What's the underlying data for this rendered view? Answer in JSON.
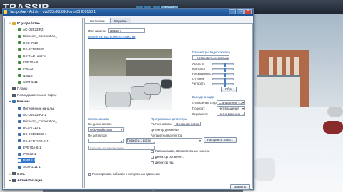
{
  "app": {
    "logo": "TRASSIR",
    "tabs": [
      "",
      "",
      "",
      "Cam1"
    ],
    "active_tab": 3
  },
  "dialog": {
    "title": "Настройки - Admin - dvd-55b98b69cKamaOhID5150 1",
    "tree": [
      {
        "label": "IP-устройства",
        "type": "section"
      },
      {
        "label": "AC-D2023IR2",
        "icon": "camera"
      },
      {
        "label": "Brickcom_Corporation_",
        "icon": "camera"
      },
      {
        "label": "DCS-7110",
        "icon": "camera"
      },
      {
        "label": "DS-2CD854-E",
        "icon": "camera"
      },
      {
        "label": "DS-2CD7164-E",
        "icon": "camera"
      },
      {
        "label": "EVB70A-6",
        "icon": "camera"
      },
      {
        "label": "IP8332",
        "icon": "camera"
      },
      {
        "label": "N5518",
        "icon": "camera"
      },
      {
        "label": "SCM-1111",
        "icon": "camera"
      },
      {
        "label": "Планы",
        "icon": "plain"
      },
      {
        "label": "Последовательные порты",
        "icon": "plain"
      },
      {
        "label": "Каналы",
        "type": "section",
        "icon": "blue"
      },
      {
        "label": "Потерянные каналы",
        "icon": "blue"
      },
      {
        "label": "AC-D2023IR2-1",
        "icon": "blue"
      },
      {
        "label": "Brickcom_Corporation_",
        "icon": "blue"
      },
      {
        "label": "DCS-7110 1",
        "icon": "blue"
      },
      {
        "label": "DS-2CD854-E-1",
        "icon": "blue"
      },
      {
        "label": "DS-2CD7164-E-1",
        "icon": "blue"
      },
      {
        "label": "EVB70A-6-1",
        "icon": "blue"
      },
      {
        "label": "IP8332 1",
        "icon": "blue"
      },
      {
        "label": "N5518 1",
        "icon": "blue",
        "selected": true
      },
      {
        "label": "SCM-1111 1",
        "icon": "blue"
      },
      {
        "label": "Сеть",
        "type": "section",
        "icon": "plain"
      },
      {
        "label": "Автоматизация",
        "type": "section",
        "icon": "plain"
      }
    ],
    "tabs": [
      "Настройки",
      "Справка"
    ],
    "name_label": "Имя канала:",
    "name_value": "N5518 1",
    "device_link": "Перейти к настройке устройства",
    "timestamp": "09:37:14",
    "video_params": {
      "header": "Параметры видеосигнала",
      "preset_label": "-- Установить несколько --",
      "rows": [
        "Яркость",
        "Контраст",
        "Насыщенность",
        "Оттенок",
        "Четкость"
      ],
      "save": "Сбрс"
    },
    "fps": {
      "header": "Выход на кадр",
      "rows": [
        {
          "label": "Отношение сторон:",
          "value": "Стандартная 4:3"
        },
        {
          "label": "Поворот:",
          "value": "Нет вращения"
        },
        {
          "label": "Зеркалить:",
          "value": "Нет отражения"
        }
      ]
    },
    "archive": {
      "header": "Запись архива",
      "rows": [
        {
          "label": "На диске архиве",
          "value": "Обычный поток"
        },
        {
          "label": "По детектору",
          "value": ""
        }
      ],
      "schedule_btn": "Перейти к расписанию",
      "note": "Сегодня по расписанию"
    },
    "detectors": {
      "header": "Программные детекторы",
      "rows": [
        {
          "label": "Распознавать:",
          "value": "Основной поток"
        },
        {
          "label": "Детектор движения",
          "value": ""
        },
        {
          "label": "Аппаратный детектор",
          "value": ""
        }
      ],
      "setup_btn": "Настроить зоны...",
      "checks": [
        "Распознавать автомобильные номера",
        "Детектор оставлен...",
        "Детектор лиц"
      ]
    },
    "checkbox_bottom": "Генерировать события о потерянных движении",
    "close_btn": "Закрыть"
  },
  "camera_label": "Садовая 01"
}
